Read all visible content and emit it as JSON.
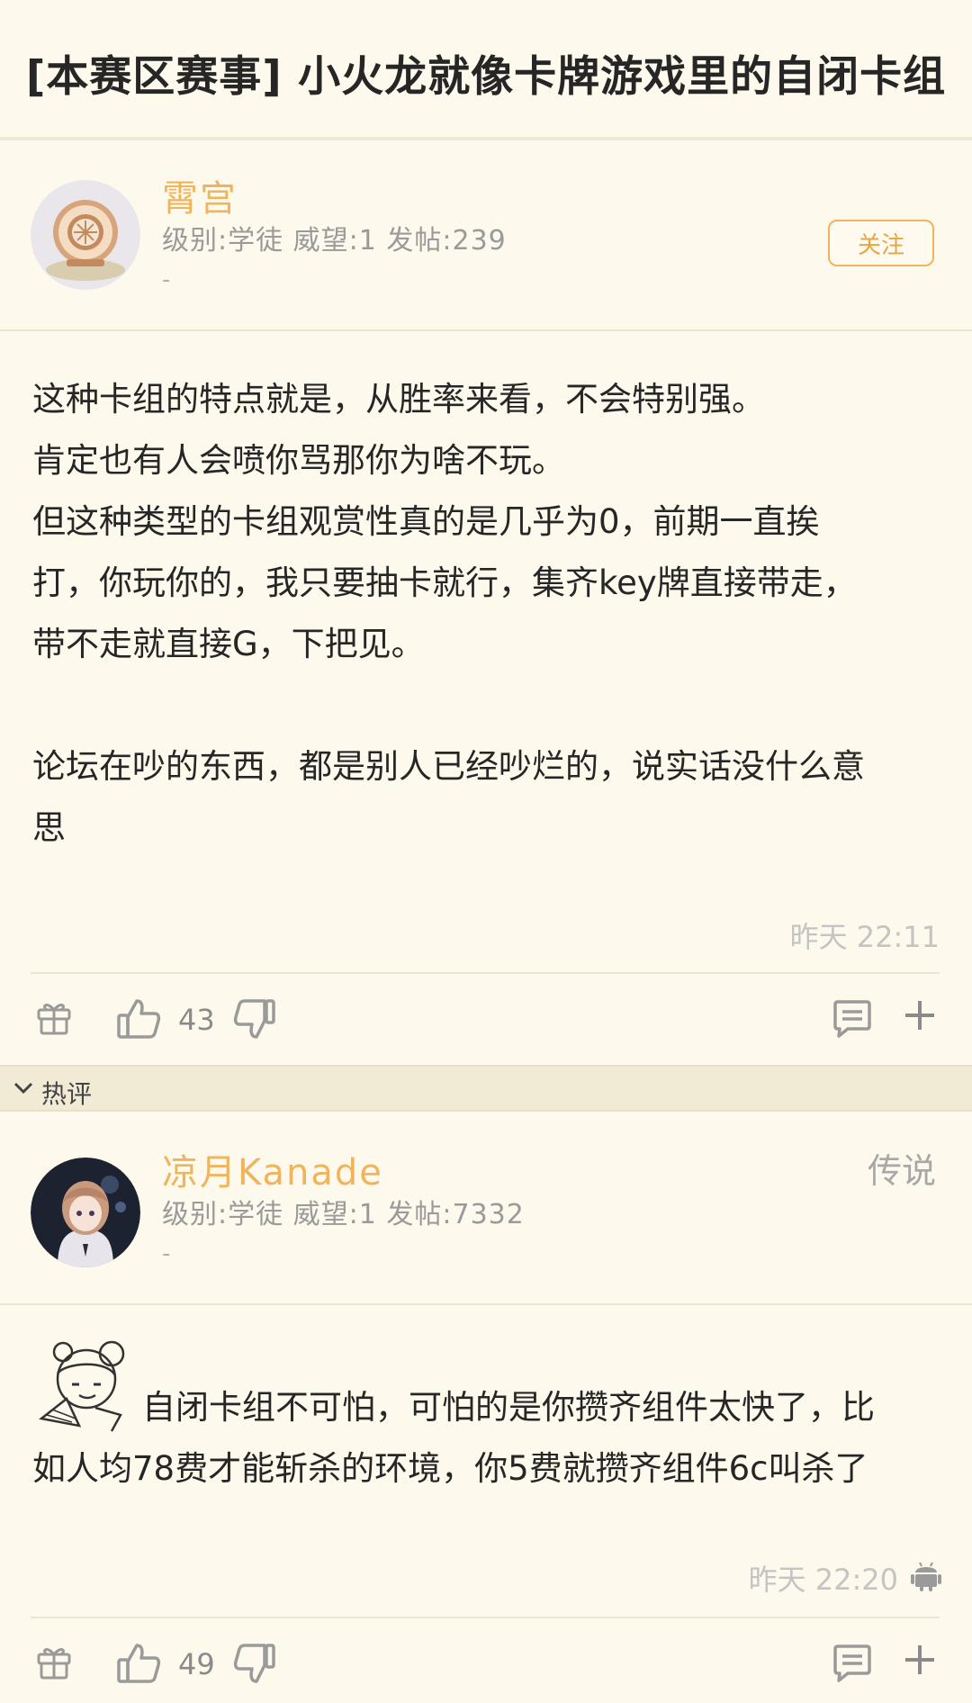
{
  "thread": {
    "title": "[本赛区赛事] 小火龙就像卡牌游戏里的自闭卡组"
  },
  "main_post": {
    "author": {
      "name": "霄宫",
      "meta": "级别:学徒 威望:1 发帖:239",
      "dash": "-"
    },
    "follow_label": "关注",
    "paragraphs": [
      "这种卡组的特点就是，从胜率来看，不会特别强。",
      "肯定也有人会喷你骂那你为啥不玩。",
      "但这种类型的卡组观赏性真的是几乎为0，前期一直挨",
      "打，你玩你的，我只要抽卡就行，集齐key牌直接带走，",
      "带不走就直接G，下把见。",
      "",
      "论坛在吵的东西，都是别人已经吵烂的，说实话没什么意",
      "思"
    ],
    "time": "昨天 22:11",
    "likes": "43",
    "icons": [
      "gift-icon",
      "thumbs-up-icon",
      "thumbs-down-icon",
      "comment-icon",
      "plus-icon"
    ]
  },
  "hot_section": {
    "label": "热评"
  },
  "hot_comment": {
    "author": {
      "name": "凉月Kanade",
      "meta": "级别:学徒 威望:1 发帖:7332",
      "dash": "-",
      "rank": "传说"
    },
    "lines": [
      "自闭卡组不可怕，可怕的是你攒齐组件太快了，比",
      "如人均78费才能斩杀的环境，你5费就攒齐组件6c叫杀了"
    ],
    "time": "昨天 22:20",
    "likes": "49",
    "icons": [
      "android-icon",
      "gift-icon",
      "thumbs-up-icon",
      "thumbs-down-icon",
      "comment-icon",
      "plus-icon"
    ]
  },
  "colors": {
    "background": "#fdf9ec",
    "accent": "#f0b45c",
    "hot_bar": "#f1ebd6"
  }
}
